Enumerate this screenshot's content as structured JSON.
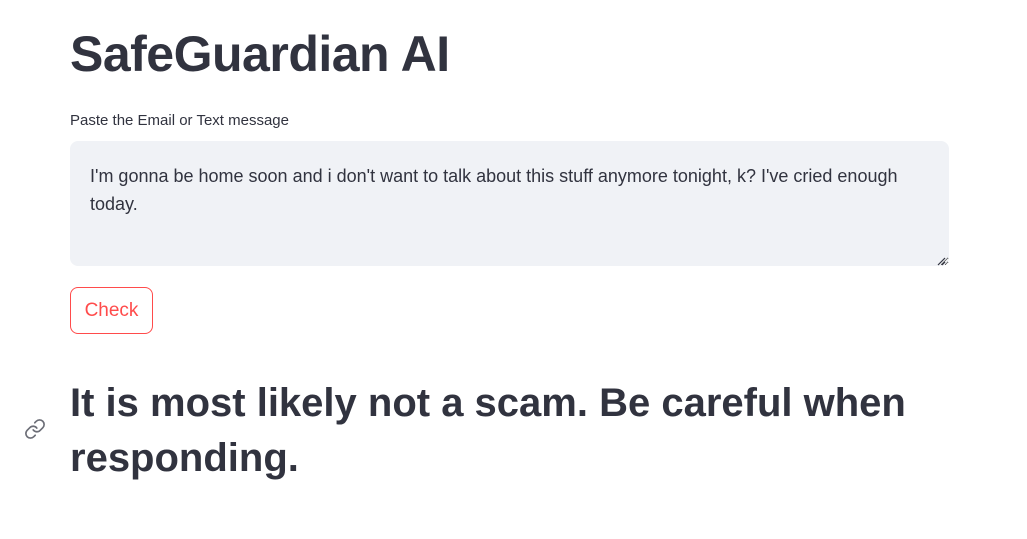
{
  "app": {
    "title": "SafeGuardian AI"
  },
  "form": {
    "label": "Paste the Email or Text message",
    "message_value": "I'm gonna be home soon and i don't want to talk about this stuff anymore tonight, k? I've cried enough today.",
    "check_button_label": "Check"
  },
  "result": {
    "text": "It is most likely not a scam. Be careful when responding."
  },
  "colors": {
    "accent": "#ff4b4b",
    "text": "#31333f",
    "input_background": "#f0f2f6"
  },
  "icons": {
    "anchor": "link-icon",
    "resize": "resize-grip-icon"
  }
}
